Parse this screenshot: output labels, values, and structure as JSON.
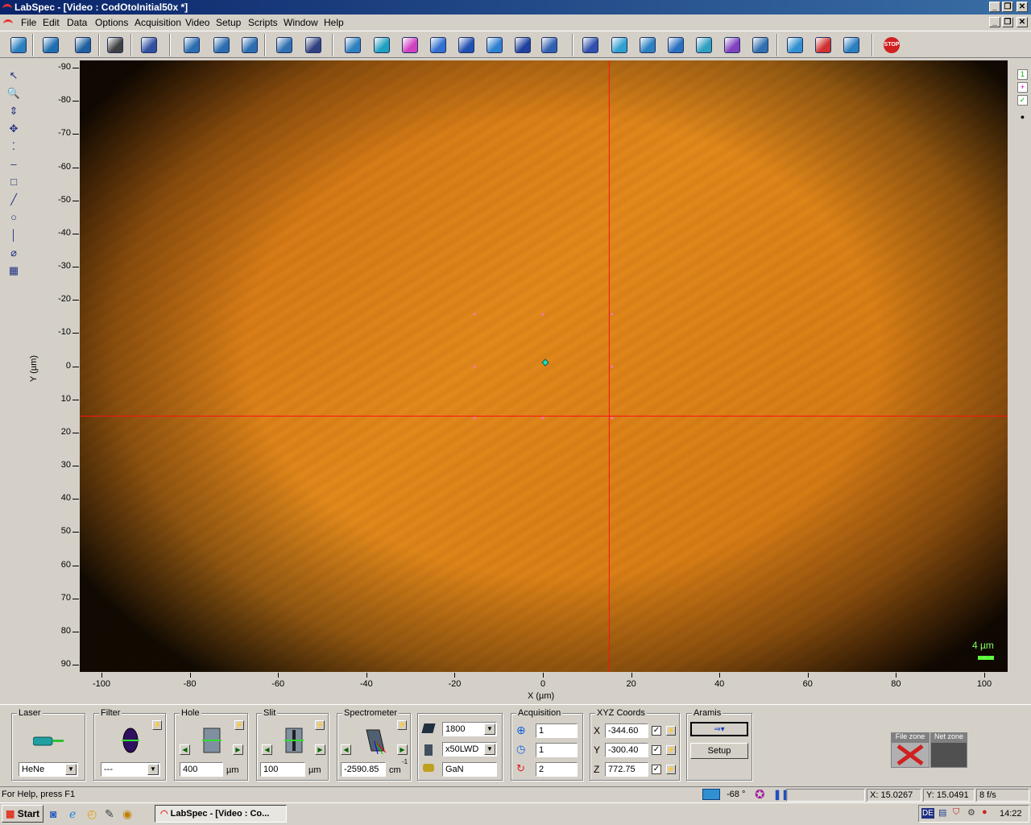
{
  "window": {
    "title": "LabSpec - [Video : CodOtoInitial50x *]",
    "min": "_",
    "max": "❐",
    "close": "✕"
  },
  "menu": [
    "File",
    "Edit",
    "Data",
    "Options",
    "Acquisition",
    "Video",
    "Setup",
    "Scripts",
    "Window",
    "Help"
  ],
  "toolbar": {
    "colors": [
      "#2a7fbf",
      "#1e6fb0",
      "#2060a0",
      "#404040",
      "#3050a0",
      "#2a6db0",
      "#2a6db0",
      "#2a6db0",
      "#3070b0",
      "#304080",
      "#3080c0",
      "#20a0c0",
      "#d040c0",
      "#3070d0",
      "#2050b0",
      "#3080d0",
      "#2040a0",
      "#3060b0",
      "#3050b0",
      "#30a0d0",
      "#2a80c0",
      "#2a70c0",
      "#30a0c0",
      "#8040c0",
      "#3070b0",
      "#3090d0",
      "#d03030"
    ],
    "stop_label": "STOP"
  },
  "tools": [
    "↖",
    "🔍",
    "⇕",
    "✥",
    "⁚",
    "–",
    "□",
    "╱",
    "○",
    "│",
    "⌀",
    "▦"
  ],
  "image": {
    "y_axis_label": "Y (µm)",
    "x_axis_label": "X (µm)",
    "y_ticks": [
      "-90",
      "-80",
      "-70",
      "-60",
      "-50",
      "-40",
      "-30",
      "-20",
      "-10",
      "0",
      "10",
      "20",
      "30",
      "40",
      "50",
      "60",
      "70",
      "80",
      "90"
    ],
    "x_ticks": [
      "-100",
      "-80",
      "-60",
      "-40",
      "-20",
      "0",
      "20",
      "40",
      "60",
      "80",
      "100"
    ],
    "scale_bar": "4 µm",
    "crosshair_x_um": 15.0267,
    "crosshair_y_um": 15.0491
  },
  "panel": {
    "laser": {
      "label": "Laser",
      "value": "HeNe"
    },
    "filter": {
      "label": "Filter",
      "value": "---"
    },
    "hole": {
      "label": "Hole",
      "value": "400",
      "unit": "µm"
    },
    "slit": {
      "label": "Slit",
      "value": "100",
      "unit": "µm"
    },
    "spectrometer": {
      "label": "Spectrometer",
      "value": "-2590.85",
      "unit": "cm",
      "exp": "-1"
    },
    "grating": {
      "value": "1800",
      "objective": "x50LWD",
      "sample": "GaN"
    },
    "acquisition": {
      "label": "Acquisition",
      "v1": "1",
      "v2": "1",
      "v3": "2"
    },
    "xyz": {
      "label": "XYZ Coords",
      "x_label": "X",
      "y_label": "Y",
      "z_label": "Z",
      "x": "-344.60",
      "y": "-300.40",
      "z": "772.75"
    },
    "aramis": {
      "label": "Aramis",
      "setup": "Setup"
    },
    "file_zone": "File zone",
    "net_zone": "Net zone"
  },
  "status": {
    "help": "For Help, press F1",
    "temp": "-68 °",
    "x": "X: 15.0267",
    "y": "Y: 15.0491",
    "fps": "8 f/s"
  },
  "taskbar": {
    "start": "Start",
    "task": "LabSpec - [Video : Co...",
    "lang": "DE",
    "clock": "14:22"
  }
}
